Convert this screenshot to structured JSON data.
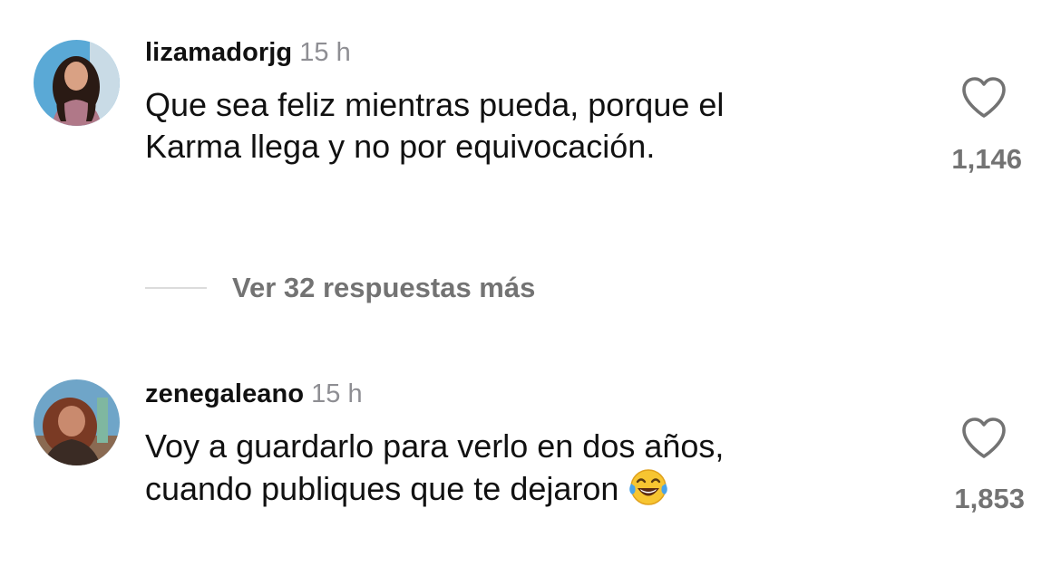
{
  "comments": [
    {
      "username": "lizamadorjg",
      "timestamp": "15 h",
      "text_lines": [
        "Que sea feliz mientras pueda, porque el",
        "Karma llega y no por equivocación."
      ],
      "likes": "1,146",
      "avatar_bg": "#5aa9d6"
    },
    {
      "username": "zenegaleano",
      "timestamp": "15 h",
      "text_lines": [
        "Voy a guardarlo para verlo en dos años,",
        "cuando publiques que te dejaron"
      ],
      "emoji": "face-with-tears-of-joy",
      "likes": "1,853",
      "avatar_bg": "#6fa5c8"
    }
  ],
  "replies": {
    "label": "Ver 32 respuestas más"
  },
  "icons": {
    "like": "heart-outline-icon"
  },
  "colors": {
    "primary_text": "#111111",
    "secondary_text": "#737373",
    "timestamp": "#8e8e93",
    "divider": "#dbdbdb"
  }
}
